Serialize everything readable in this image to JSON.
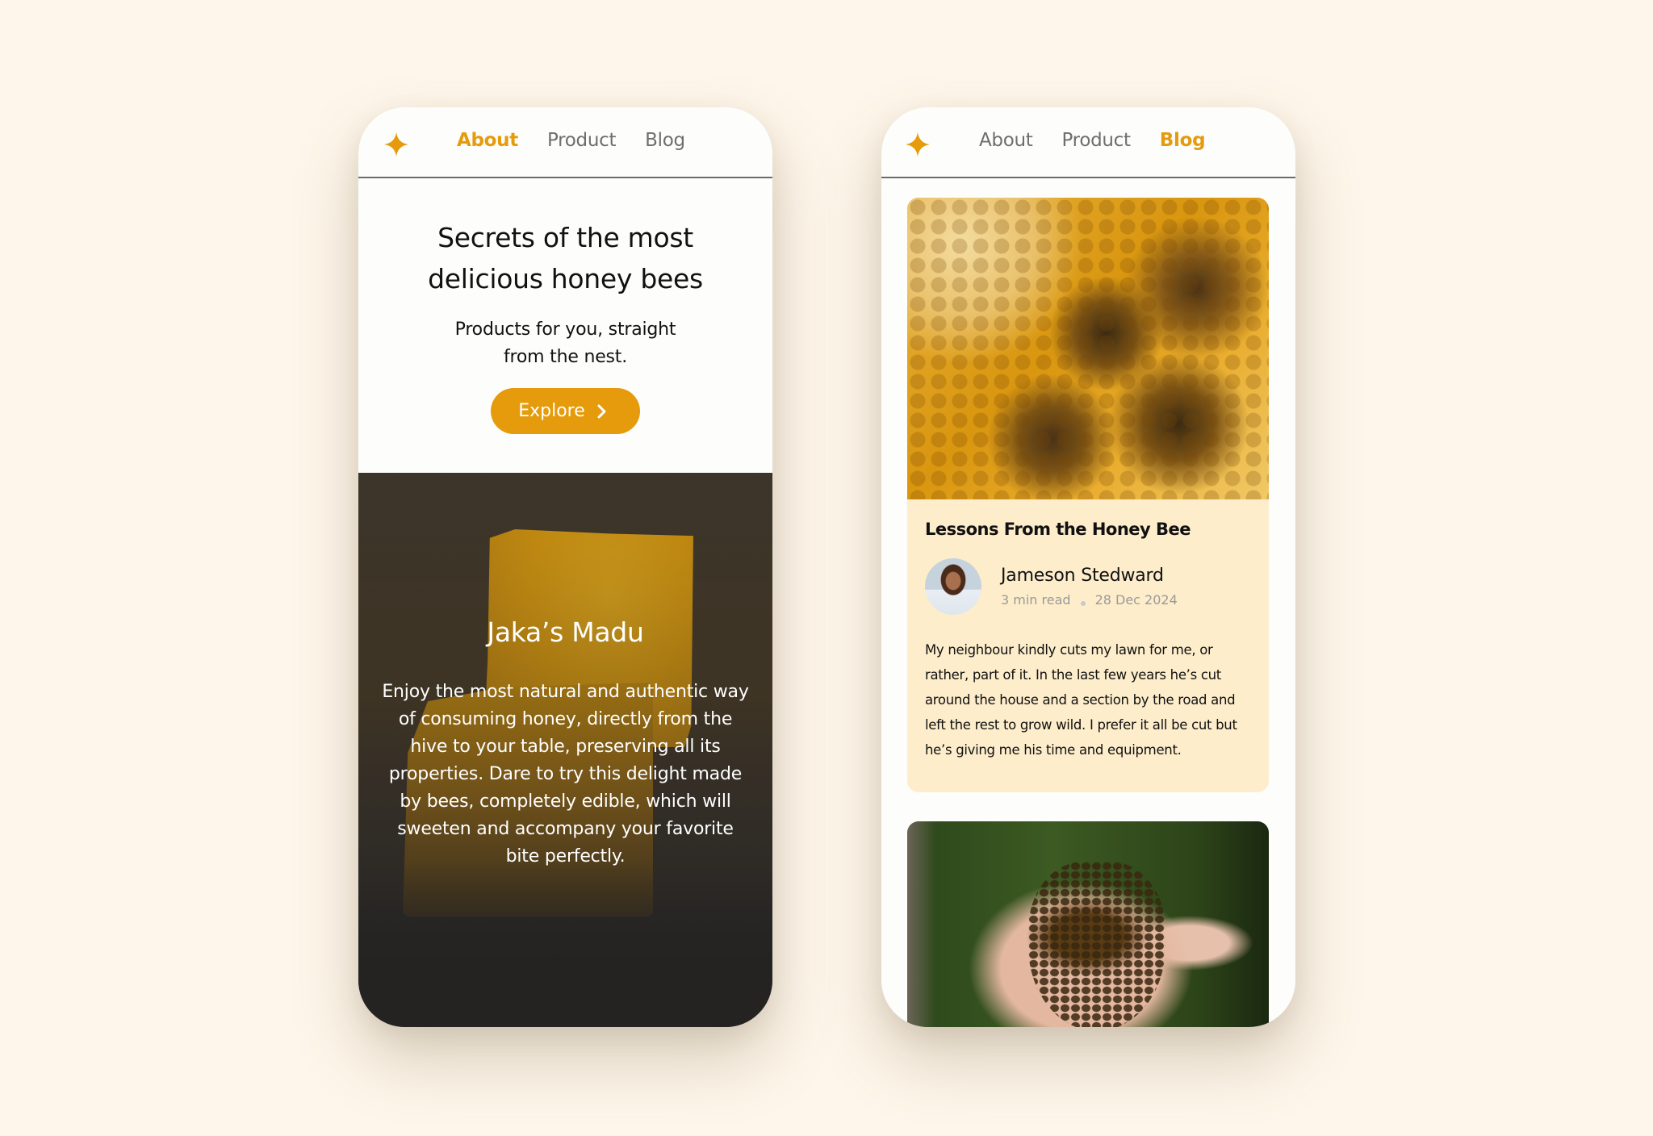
{
  "brand": {
    "accent_color": "#E59B0B",
    "logo_icon": "four-point-star-icon"
  },
  "nav": {
    "items": [
      "About",
      "Product",
      "Blog"
    ]
  },
  "about_screen": {
    "active_nav": "About",
    "hero": {
      "title_line1": "Secrets of the most",
      "title_line2": "delicious honey bees",
      "subtitle_line1": "Products for you, straight",
      "subtitle_line2": "from the nest.",
      "cta_label": "Explore",
      "cta_icon": "chevron-right-icon"
    },
    "product": {
      "title": "Jaka’s Madu",
      "description": "Enjoy the most natural and authentic way of consuming honey, directly from the hive to your table, preserving all its properties. Dare to try this delight made by bees, completely edible, which will sweeten and accompany your favorite bite perfectly."
    }
  },
  "blog_screen": {
    "active_nav": "Blog",
    "posts": [
      {
        "title": "Lessons From the Honey Bee",
        "author": "Jameson Stedward",
        "read_time": "3 min read",
        "date": "28 Dec 2024",
        "excerpt": "My neighbour kindly cuts my lawn for me, or rather, part of it. In the last few years he’s cut around the house and a section by the road and left the rest to grow wild. I prefer it all be cut but he’s giving me his time and equipment.",
        "image": "bees-on-honeycomb-photo"
      },
      {
        "image": "hand-holding-bees-photo"
      }
    ]
  }
}
